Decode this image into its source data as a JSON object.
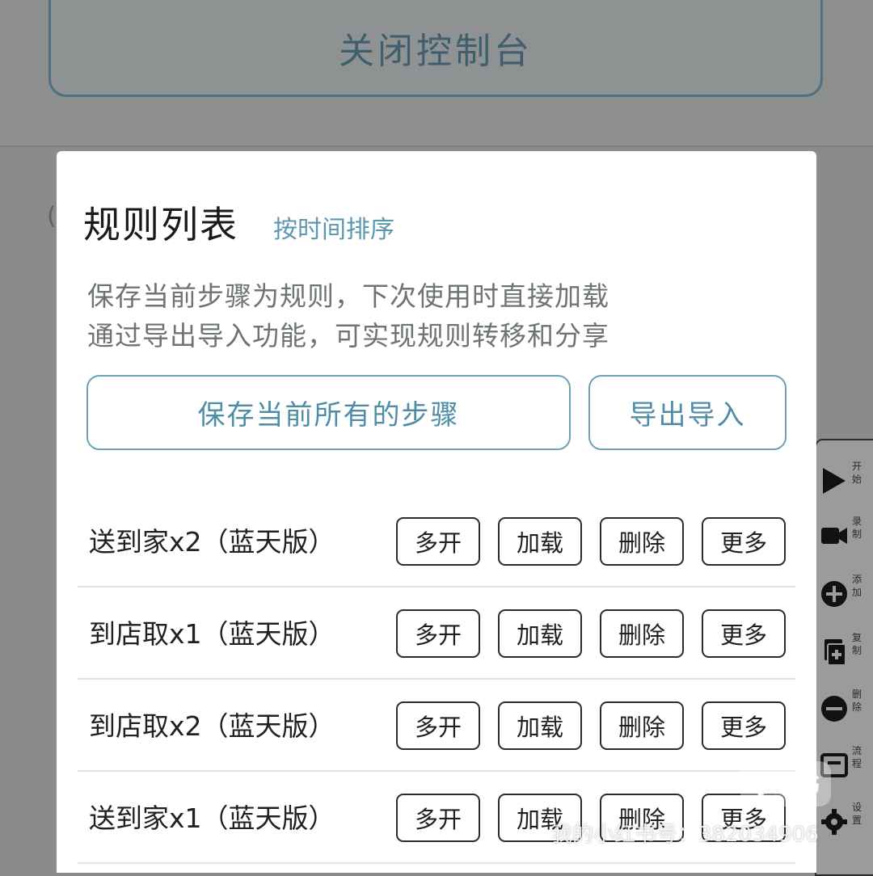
{
  "background": {
    "close_console_label": "关闭控制台",
    "left_glyph": "("
  },
  "toolbar": {
    "items": [
      {
        "label": "开始",
        "icon": "play-icon"
      },
      {
        "label": "录制",
        "icon": "record-icon"
      },
      {
        "label": "添加",
        "icon": "add-icon"
      },
      {
        "label": "复制",
        "icon": "copy-icon"
      },
      {
        "label": "删除",
        "icon": "remove-icon"
      },
      {
        "label": "流程",
        "icon": "flow-icon"
      },
      {
        "label": "设置",
        "icon": "settings-icon"
      }
    ]
  },
  "modal": {
    "title": "规则列表",
    "sort_label": "按时间排序",
    "desc_line1": "保存当前步骤为规则，下次使用时直接加载",
    "desc_line2": "通过导出导入功能，可实现规则转移和分享",
    "save_all_label": "保存当前所有的步骤",
    "export_import_label": "导出导入",
    "rules": [
      {
        "name": "送到家x2（蓝天版）"
      },
      {
        "name": "到店取x1（蓝天版）"
      },
      {
        "name": "到店取x2（蓝天版）"
      },
      {
        "name": "送到家x1（蓝天版）"
      }
    ],
    "actions": {
      "multi_open": "多开",
      "load": "加载",
      "delete": "删除",
      "more": "更多"
    }
  },
  "watermark": {
    "logo_text": "小红书",
    "id_text": "我的小红书号：382034906"
  },
  "colors": {
    "accent": "#5c97b2",
    "button_border": "#6aa3b8",
    "overlay": "#8a8c8c"
  }
}
